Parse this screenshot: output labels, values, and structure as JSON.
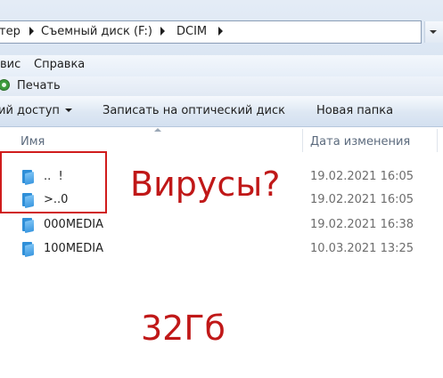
{
  "address": {
    "crumbs": [
      "тер",
      "Съемный диск (F:)",
      "DCIM"
    ]
  },
  "menu": {
    "items": [
      "вис",
      "Справка"
    ]
  },
  "printbar": {
    "print_label": "Печать"
  },
  "toolbar": {
    "buttons": [
      "ий доступ",
      "Записать на оптический диск",
      "Новая папка"
    ]
  },
  "columns": {
    "name": "Имя",
    "date": "Дата изменения"
  },
  "files": [
    {
      "name": "..  !",
      "date": "19.02.2021 16:05",
      "icon": "folder-icon"
    },
    {
      "name": ">..0",
      "date": "19.02.2021 16:05",
      "icon": "folder-icon"
    },
    {
      "name": "000MEDIA",
      "date": "19.02.2021 16:38",
      "icon": "folder-icon"
    },
    {
      "name": "100MEDIA",
      "date": "10.03.2021 13:25",
      "icon": "folder-icon"
    }
  ],
  "annotations": {
    "viruses": "Вирусы?",
    "size": "32Гб",
    "color": "#c01818"
  },
  "colors": {
    "toolbar_bg": "#dde7f3",
    "folder_blue": "#3b98e0"
  }
}
